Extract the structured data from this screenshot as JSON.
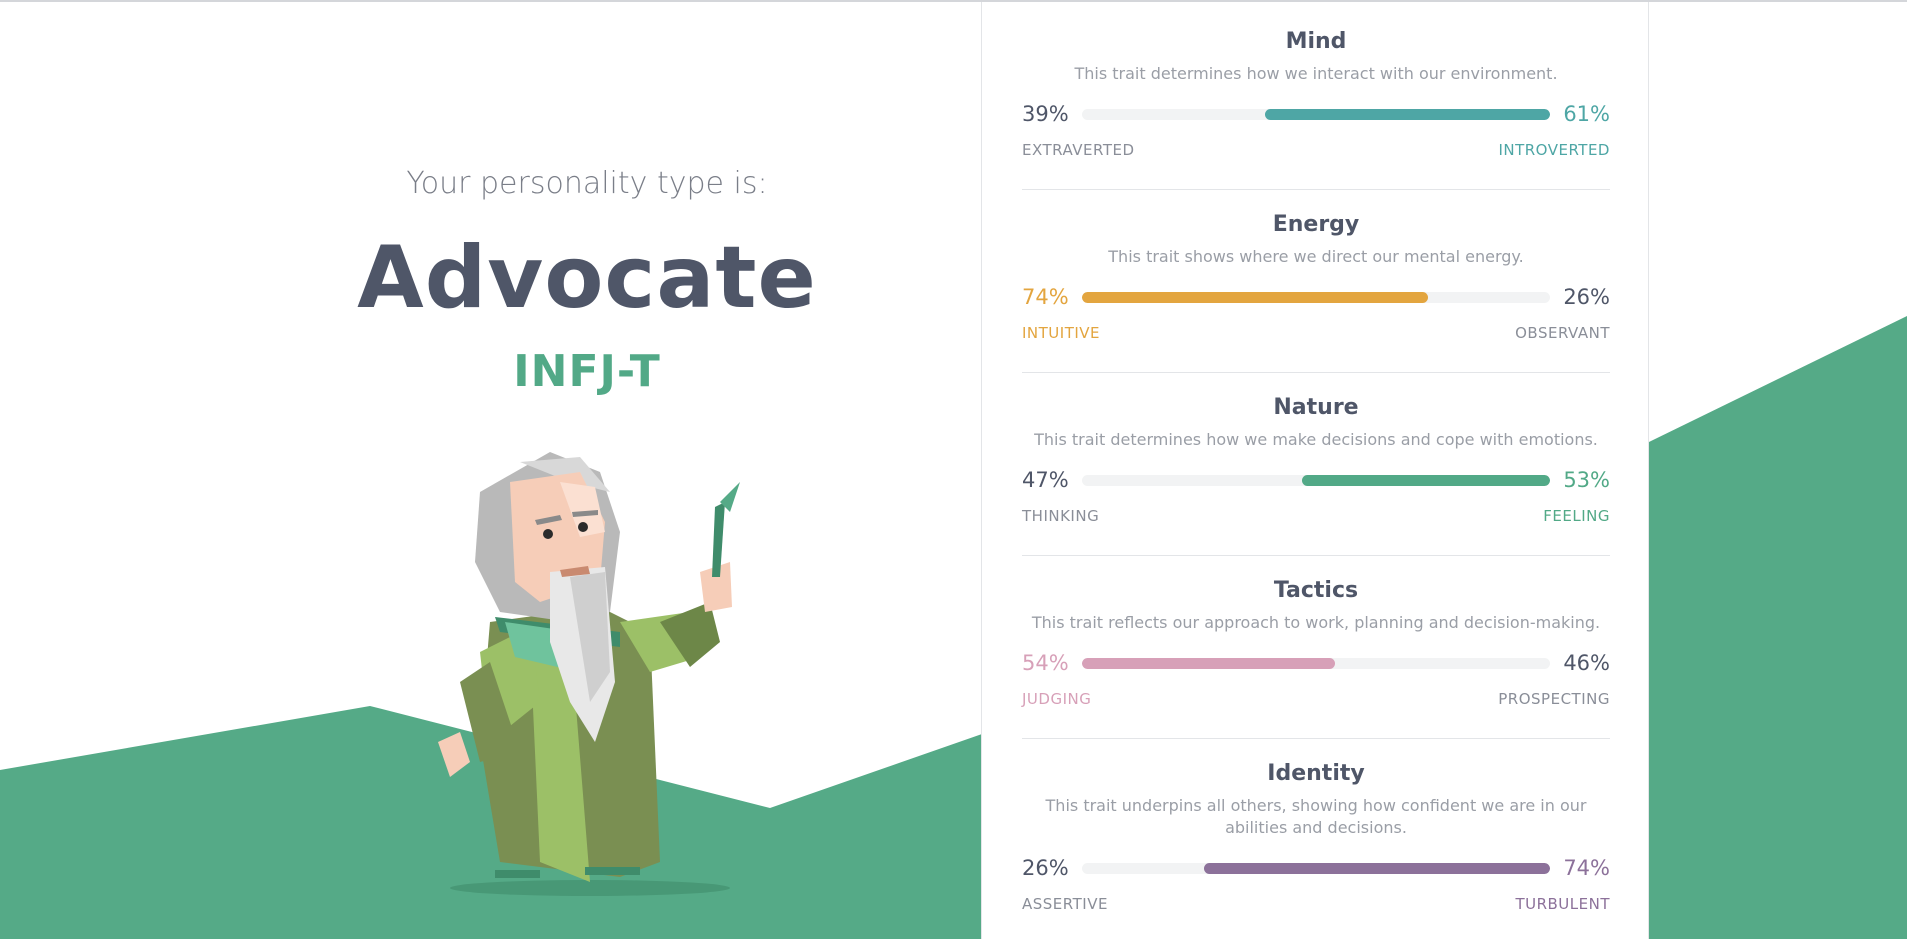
{
  "hero": {
    "intro": "Your personality type is:",
    "type_name": "Advocate",
    "type_code": "INFJ-T"
  },
  "colors": {
    "green_bg": "#55aa87",
    "mind": "#4ea6a5",
    "energy": "#e3a53f",
    "nature": "#52a987",
    "tactics": "#d7a0b8",
    "identity": "#8c719a",
    "text_dark": "#4f5668"
  },
  "traits": [
    {
      "title": "Mind",
      "description": "This trait determines how we interact with our environment.",
      "left_pct": "39%",
      "right_pct": "61%",
      "left_label": "EXTRAVERTED",
      "right_label": "INTROVERTED",
      "dominant": "right",
      "dominant_value": 61,
      "color": "#4ea6a5"
    },
    {
      "title": "Energy",
      "description": "This trait shows where we direct our mental energy.",
      "left_pct": "74%",
      "right_pct": "26%",
      "left_label": "INTUITIVE",
      "right_label": "OBSERVANT",
      "dominant": "left",
      "dominant_value": 74,
      "color": "#e3a53f"
    },
    {
      "title": "Nature",
      "description": "This trait determines how we make decisions and cope with emotions.",
      "left_pct": "47%",
      "right_pct": "53%",
      "left_label": "THINKING",
      "right_label": "FEELING",
      "dominant": "right",
      "dominant_value": 53,
      "color": "#52a987"
    },
    {
      "title": "Tactics",
      "description": "This trait reflects our approach to work, planning and decision-making.",
      "left_pct": "54%",
      "right_pct": "46%",
      "left_label": "JUDGING",
      "right_label": "PROSPECTING",
      "dominant": "left",
      "dominant_value": 54,
      "color": "#d7a0b8"
    },
    {
      "title": "Identity",
      "description": "This trait underpins all others, showing how confident we are in our abilities and decisions.",
      "left_pct": "26%",
      "right_pct": "74%",
      "left_label": "ASSERTIVE",
      "right_label": "TURBULENT",
      "dominant": "right",
      "dominant_value": 74,
      "color": "#8c719a"
    }
  ]
}
